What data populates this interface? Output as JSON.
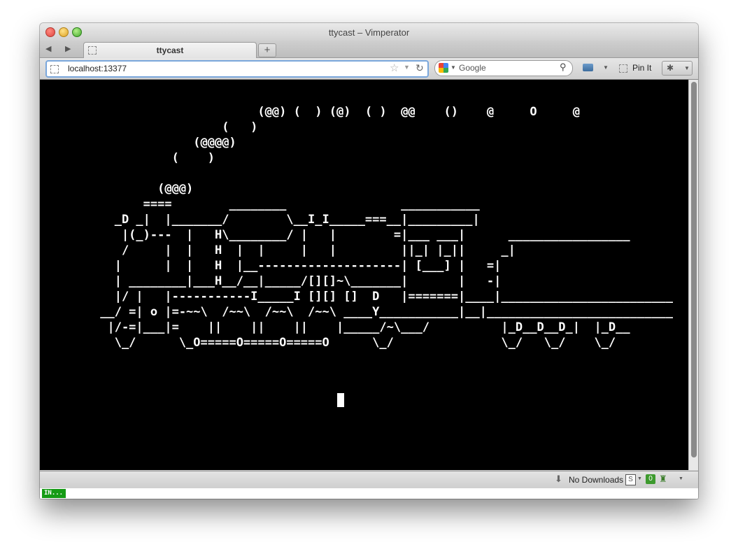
{
  "window": {
    "title": "ttycast – Vimperator"
  },
  "tabs": [
    {
      "label": "ttycast"
    }
  ],
  "new_tab_label": "+",
  "nav": {
    "back": "◀",
    "forward": "▶"
  },
  "url": {
    "value": "localhost:13377"
  },
  "search": {
    "placeholder": "Google"
  },
  "toolbar": {
    "pinit_label": "Pin It"
  },
  "addon_bar": {
    "downloads_label": "No Downloads",
    "s_label": "S",
    "badge_count": "0"
  },
  "status": {
    "mode": "IN..."
  },
  "terminal": {
    "lines": [
      "                       (@@) (  ) (@)  ( )  @@    ()    @     O     @",
      "                  (   )",
      "              (@@@@)",
      "           (    )",
      "",
      "         (@@@)",
      "       ====        ________                ___________",
      "   _D _|  |_______/        \\__I_I_____===__|_________|",
      "    |(_)---  |   H\\________/ |   |        =|___ ___|      _________________",
      "    /     |  |   H  |  |     |   |         ||_| |_||     _|",
      "   |      |  |   H  |__--------------------| [___] |   =|",
      "   | ________|___H__/__|_____/[][]~\\_______|       |   -|",
      "   |/ |   |-----------I_____I [][] []  D   |=======|____|________________________",
      " __/ =| o |=-~~\\  /~~\\  /~~\\  /~~\\ ____Y___________|__|__________________________",
      "  |/-=|___|=    ||    ||    ||    |_____/~\\___/          |_D__D__D_|  |_D__",
      "   \\_/      \\_O=====O=====O=====O      \\_/               \\_/   \\_/    \\_/"
    ]
  }
}
